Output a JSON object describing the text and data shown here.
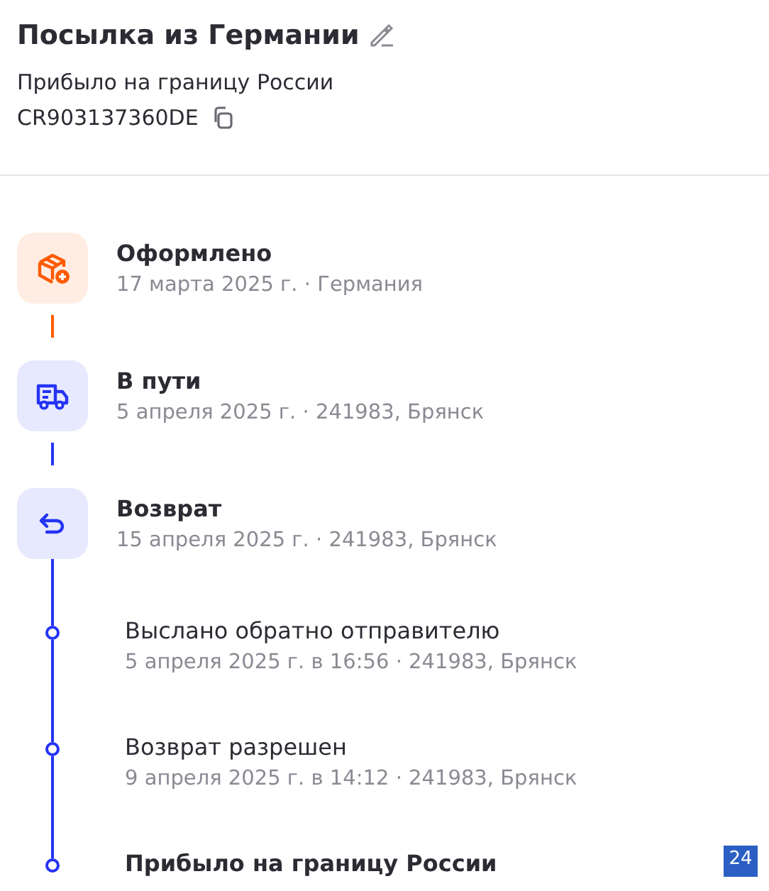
{
  "header": {
    "title": "Посылка из Германии",
    "status": "Прибыло на границу России",
    "tracking_number": "CR903137360DE"
  },
  "timeline": [
    {
      "kind": "created",
      "color": "#ff5a00",
      "title": "Оформлено",
      "detail": "17 марта 2025 г. · Германия"
    },
    {
      "kind": "transit",
      "color": "#2433f5",
      "title": "В пути",
      "detail": "5 апреля 2025 г. · 241983, Брянск"
    },
    {
      "kind": "returned",
      "color": "#2433f5",
      "title": "Возврат",
      "detail": "15 апреля 2025 г. · 241983, Брянск"
    },
    {
      "kind": "event",
      "color": "#2433f5",
      "title": "Выслано обратно отправителю",
      "detail": "5 апреля 2025 г. в 16:56 · 241983, Брянск"
    },
    {
      "kind": "event",
      "color": "#2433f5",
      "title": "Возврат разрешен",
      "detail": "9 апреля 2025 г. в 14:12 · 241983, Брянск"
    },
    {
      "kind": "latest",
      "color": "#2433f5",
      "title": "Прибыло на границу России"
    }
  ],
  "badge": "24"
}
